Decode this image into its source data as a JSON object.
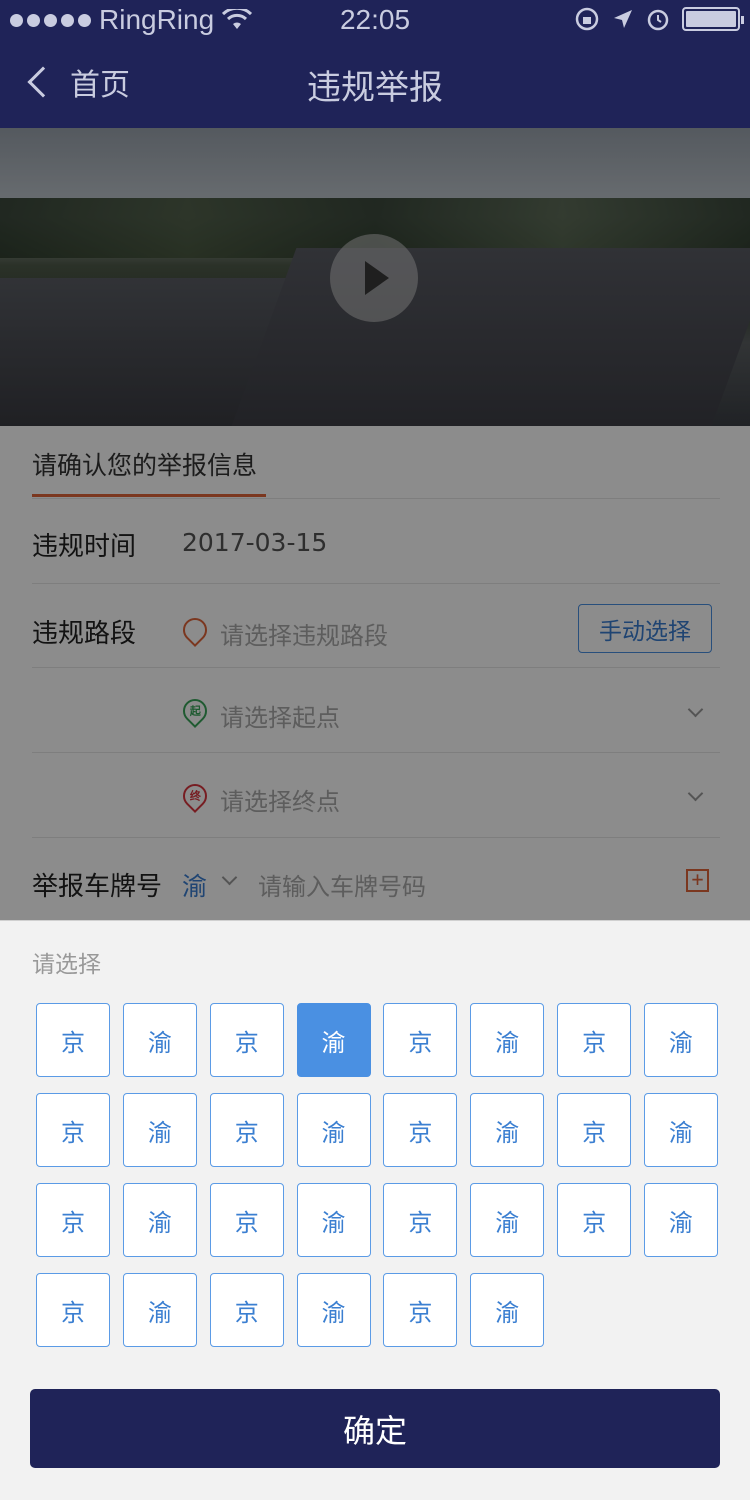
{
  "status_bar": {
    "carrier": "RingRing",
    "time": "22:05",
    "icons": [
      "signal-dots-icon",
      "wifi-icon",
      "rotation-lock-icon",
      "location-arrow-icon",
      "alarm-icon",
      "battery-icon"
    ]
  },
  "nav": {
    "back_label": "首页",
    "title": "违规举报"
  },
  "form": {
    "section_title": "请确认您的举报信息",
    "time_label": "违规时间",
    "time_value": "2017-03-15",
    "route_label": "违规路段",
    "route_placeholder": "请选择违规路段",
    "manual_button": "手动选择",
    "start_badge": "起",
    "start_placeholder": "请选择起点",
    "end_badge": "终",
    "end_placeholder": "请选择终点",
    "plate_label": "举报车牌号",
    "plate_prefix": "渝",
    "plate_placeholder": "请输入车牌号码",
    "plus_glyph": "+"
  },
  "picker": {
    "title": "请选择",
    "keys": [
      "京",
      "渝",
      "京",
      "渝",
      "京",
      "渝",
      "京",
      "渝",
      "京",
      "渝",
      "京",
      "渝",
      "京",
      "渝",
      "京",
      "渝",
      "京",
      "渝",
      "京",
      "渝",
      "京",
      "渝",
      "京",
      "渝",
      "京",
      "渝",
      "京",
      "渝",
      "京",
      "渝"
    ],
    "selected_index": 3,
    "confirm_label": "确定"
  },
  "colors": {
    "nav_bg": "#1f2358",
    "accent_blue": "#4a90e2",
    "accent_orange": "#e0643a"
  }
}
